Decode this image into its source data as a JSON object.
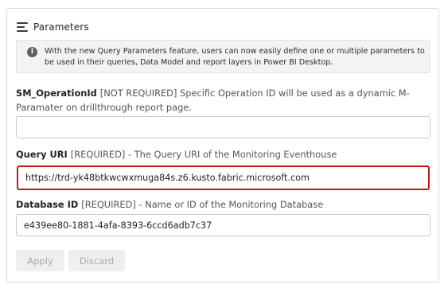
{
  "panel": {
    "title": "Parameters",
    "icon": "menu-lines-icon"
  },
  "info": {
    "icon": "info-icon",
    "glyph": "i",
    "text": "With the new Query Parameters feature, users can now easily define one or multiple parameters to be used in their queries, Data Model and report layers in Power BI Desktop."
  },
  "fields": [
    {
      "name": "SM_OperationId",
      "description": "[NOT REQUIRED] Specific Operation ID will be used as a dynamic M-Paramater on drillthrough report page.",
      "value": "",
      "placeholder": ""
    },
    {
      "name": "Query URI",
      "description": "[REQUIRED] - The Query URI of the Monitoring Eventhouse",
      "value": "https://trd-yk48btkwcwxmuga84s.z6.kusto.fabric.microsoft.com",
      "placeholder": ""
    },
    {
      "name": "Database ID",
      "description": "[REQUIRED] - Name or ID of the Monitoring Database",
      "value": "e439ee80-1881-4afa-8393-6ccd6adb7c37",
      "placeholder": ""
    }
  ],
  "actions": {
    "apply_label": "Apply",
    "discard_label": "Discard"
  },
  "colors": {
    "highlight_border": "#cc1414",
    "disabled_button_bg": "#efefef",
    "disabled_button_text": "#a8a8a8"
  }
}
